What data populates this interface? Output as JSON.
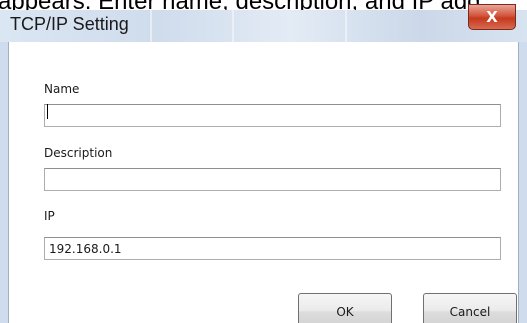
{
  "background_caption": "appears. Enter name, description, and IP add",
  "window": {
    "title": "TCP/IP Setting",
    "close_glyph": "X"
  },
  "form": {
    "name_label": "Name",
    "name_value": "",
    "description_label": "Description",
    "description_value": "",
    "ip_label": "IP",
    "ip_value": "192.168.0.1"
  },
  "buttons": {
    "ok_label": "OK",
    "cancel_label": "Cancel"
  },
  "colors": {
    "titlebar": "#d5e1ef",
    "close_button": "#c9452a",
    "field_border": "#abadb3",
    "button_face": "#e5e5e5"
  }
}
